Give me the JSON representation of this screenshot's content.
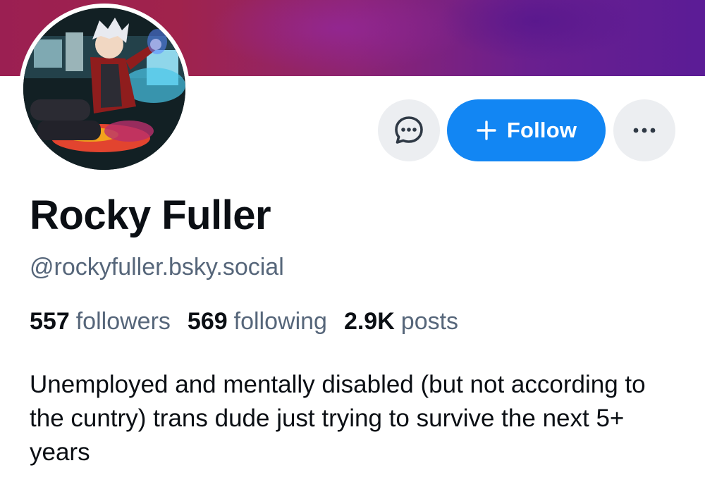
{
  "profile": {
    "display_name": "Rocky Fuller",
    "handle": "@rockyfuller.bsky.social",
    "bio": "Unemployed and mentally disabled (but not according to the cuntry) trans dude just trying to survive the next 5+ years"
  },
  "stats": {
    "followers_count": "557",
    "followers_label": "followers",
    "following_count": "569",
    "following_label": "following",
    "posts_count": "2.9K",
    "posts_label": "posts"
  },
  "actions": {
    "message_icon": "chat-bubble-icon",
    "follow_label": "Follow",
    "follow_icon": "plus-icon",
    "more_icon": "ellipsis-icon"
  },
  "colors": {
    "follow_button": "#1286f3",
    "circle_button": "#eceef1",
    "secondary_text": "#56667a",
    "primary_text": "#0b0f14",
    "banner_start": "#9b1f52",
    "banner_end": "#5b1c96"
  }
}
